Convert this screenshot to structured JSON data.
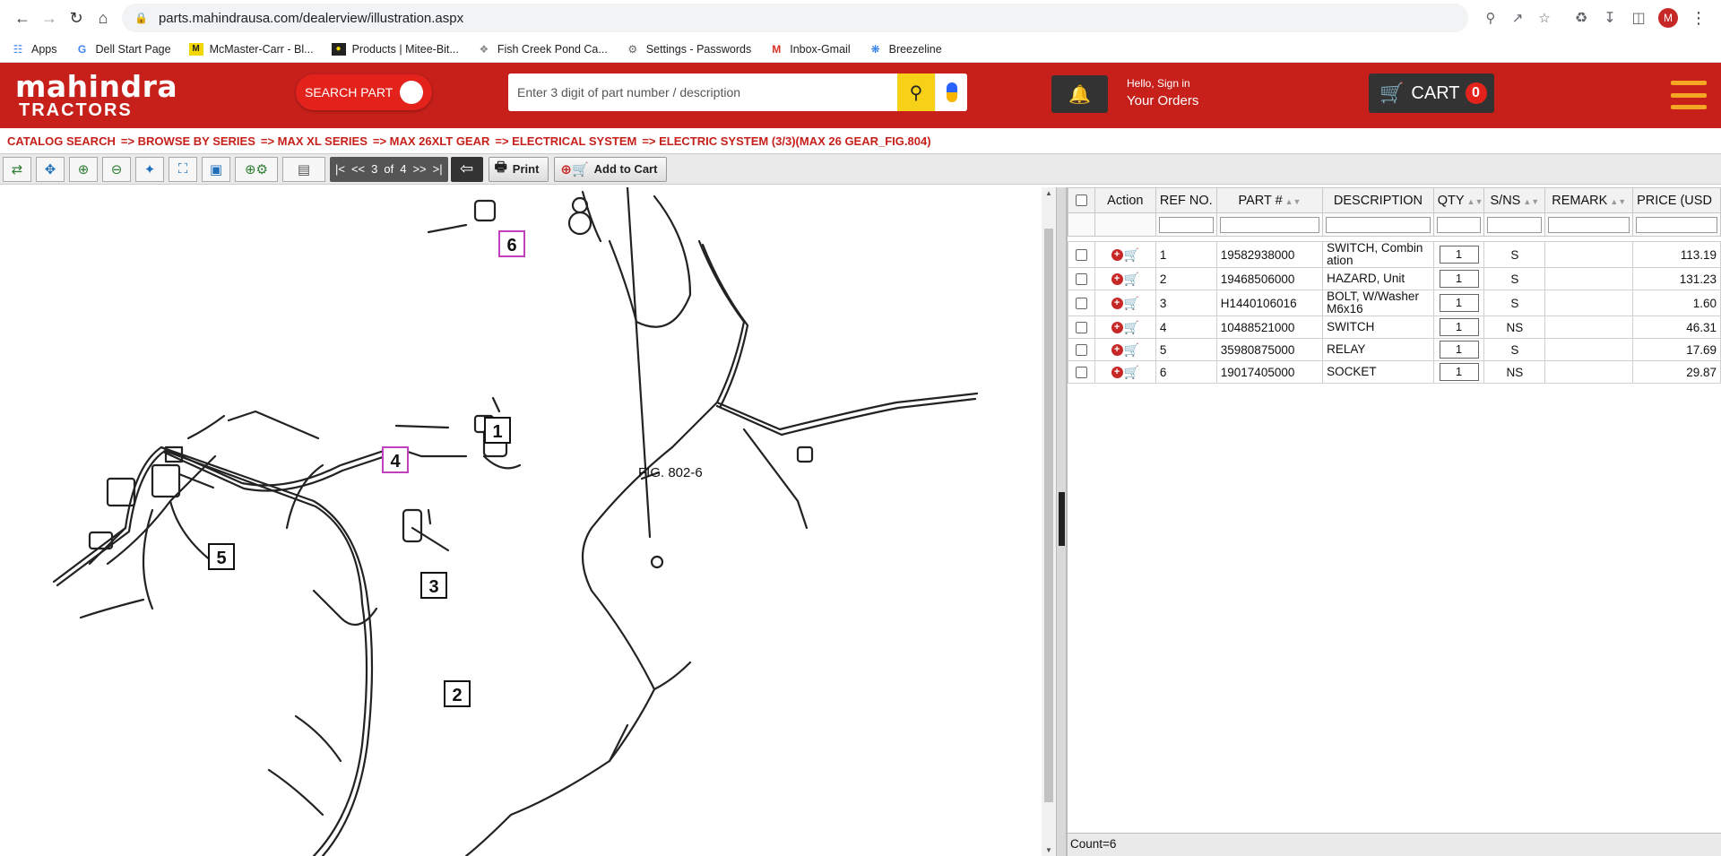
{
  "browser": {
    "url": "parts.mahindrausa.com/dealerview/illustration.aspx",
    "avatar_letter": "M",
    "bookmarks": [
      {
        "label": "Apps",
        "icon": "apps-grid-icon"
      },
      {
        "label": "Dell Start Page",
        "icon": "google-icon"
      },
      {
        "label": "McMaster-Carr - Bl...",
        "icon": "mcmaster-icon"
      },
      {
        "label": "Products | Mitee-Bit...",
        "icon": "miteebit-icon"
      },
      {
        "label": "Fish Creek Pond Ca...",
        "icon": "fish-icon"
      },
      {
        "label": "Settings - Passwords",
        "icon": "gear-icon"
      },
      {
        "label": "Inbox-Gmail",
        "icon": "gmail-icon"
      },
      {
        "label": "Breezeline",
        "icon": "breezeline-icon"
      }
    ]
  },
  "header": {
    "logo_line1": "mahindra",
    "logo_line2": "TRACTORS",
    "search_toggle_label": "SEARCH PART",
    "search_placeholder": "Enter 3 digit of part number / description",
    "signin_line1": "Hello, Sign in",
    "signin_line2": "Your Orders",
    "cart_label": "CART",
    "cart_count": "0"
  },
  "breadcrumb": [
    "CATALOG SEARCH",
    "=> BROWSE BY SERIES",
    "=> MAX XL SERIES",
    "=> MAX 26XLT GEAR",
    "=> ELECTRICAL SYSTEM",
    "=> ELECTRIC SYSTEM (3/3)(MAX 26 GEAR_FIG.804)"
  ],
  "toolbar": {
    "pager_first": "|<",
    "pager_prev": "<<",
    "pager_current": "3",
    "pager_of": "of",
    "pager_total": "4",
    "pager_next": ">>",
    "pager_last": ">|",
    "print_label": "Print",
    "add_to_cart_label": "Add to Cart"
  },
  "illustration": {
    "figure_label": "FIG. 802-6",
    "callouts": [
      "1",
      "2",
      "3",
      "4",
      "5",
      "6"
    ]
  },
  "table": {
    "headers": {
      "action": "Action",
      "ref": "REF NO.",
      "part": "PART #",
      "description": "DESCRIPTION",
      "qty": "QTY",
      "sns": "S/NS",
      "remark": "REMARK",
      "price": "PRICE (USD"
    },
    "rows": [
      {
        "ref": "1",
        "part": "19582938000",
        "desc": "SWITCH, Combin ation",
        "qty": "1",
        "sns": "S",
        "remark": "",
        "price": "113.19"
      },
      {
        "ref": "2",
        "part": "19468506000",
        "desc": "HAZARD, Unit",
        "qty": "1",
        "sns": "S",
        "remark": "",
        "price": "131.23"
      },
      {
        "ref": "3",
        "part": "H1440106016",
        "desc": "BOLT, W/Washer M6x16",
        "qty": "1",
        "sns": "S",
        "remark": "",
        "price": "1.60"
      },
      {
        "ref": "4",
        "part": "10488521000",
        "desc": "SWITCH",
        "qty": "1",
        "sns": "NS",
        "remark": "",
        "price": "46.31"
      },
      {
        "ref": "5",
        "part": "35980875000",
        "desc": "RELAY",
        "qty": "1",
        "sns": "S",
        "remark": "",
        "price": "17.69"
      },
      {
        "ref": "6",
        "part": "19017405000",
        "desc": "SOCKET",
        "qty": "1",
        "sns": "NS",
        "remark": "",
        "price": "29.87"
      }
    ],
    "count_text": "Count=6"
  }
}
